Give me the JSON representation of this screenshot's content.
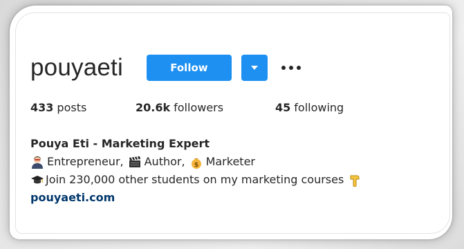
{
  "profile": {
    "username": "pouyaeti",
    "follow_label": "Follow"
  },
  "stats": {
    "posts_count": "433",
    "posts_label": "posts",
    "followers_count": "20.6k",
    "followers_label": "followers",
    "following_count": "45",
    "following_label": "following"
  },
  "bio": {
    "name": "Pouya Eti - Marketing Expert",
    "role1": "Entrepreneur,",
    "role2": "Author,",
    "role3": "Marketer",
    "line3": "Join 230,000 other students on my marketing courses",
    "link": "pouyaeti.com"
  },
  "colors": {
    "accent": "#1e90f2",
    "link": "#00376b",
    "text": "#262626"
  },
  "icons": [
    "chevron-down-icon",
    "more-options-icon",
    "person-emoji-icon",
    "clapperboard-emoji-icon",
    "money-bag-emoji-icon",
    "graduation-cap-emoji-icon",
    "pointing-down-emoji-icon"
  ]
}
